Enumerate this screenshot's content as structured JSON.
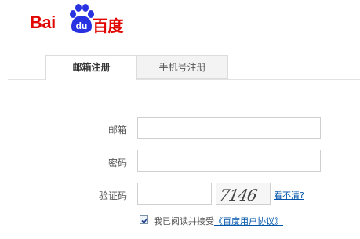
{
  "logo": {
    "text_latin": "Bai",
    "paw_text": "du",
    "text_cn": "百度",
    "brand_red": "#e10602",
    "brand_blue": "#2932e1"
  },
  "tabs": [
    {
      "label": "邮箱注册",
      "active": true
    },
    {
      "label": "手机号注册",
      "active": false
    }
  ],
  "form": {
    "email_label": "邮箱",
    "email_value": "",
    "password_label": "密码",
    "password_value": "",
    "captcha_label": "验证码",
    "captcha_value": "",
    "captcha_image_text": "7146",
    "refresh_link": "看不清?"
  },
  "agreement": {
    "checked": true,
    "text": "我已阅读并接受",
    "link": "《百度用户协议》"
  }
}
